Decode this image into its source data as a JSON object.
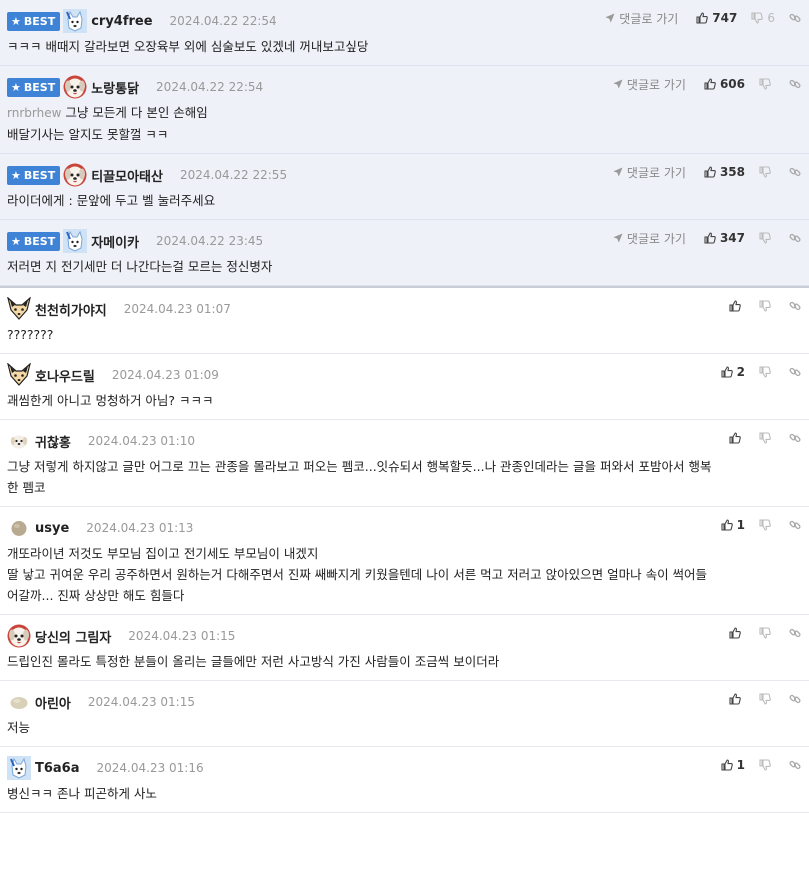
{
  "best_label": "BEST",
  "reply_label": "댓글로 가기",
  "comments": [
    {
      "best": true,
      "avatar": "bluedog-icon",
      "nick": "cry4free",
      "date": "2024.04.22 22:54",
      "up": "747",
      "down": "6",
      "mention": "",
      "lines": [
        "ㅋㅋㅋ 배때지 갈라보면 오장육부 외에 심술보도 있겠네 꺼내보고싶당"
      ]
    },
    {
      "best": true,
      "avatar": "maltese-icon",
      "nick": "노랑통닭",
      "date": "2024.04.22 22:54",
      "up": "606",
      "down": "",
      "mention": "rnrbrhew",
      "lines": [
        "그냥 모든게 다 본인 손해임",
        "배달기사는 알지도 못할껄 ㅋㅋ"
      ]
    },
    {
      "best": true,
      "avatar": "maltese-icon",
      "nick": "티끌모아태산",
      "date": "2024.04.22 22:55",
      "up": "358",
      "down": "",
      "mention": "",
      "lines": [
        "라이더에게 : 문앞에 두고 벨 눌러주세요"
      ]
    },
    {
      "best": true,
      "avatar": "bluedog-icon",
      "nick": "자메이카",
      "date": "2024.04.22 23:45",
      "up": "347",
      "down": "",
      "mention": "",
      "lines": [
        "저러면 지 전기세만 더 나간다는걸 모르는 정신병자"
      ]
    },
    {
      "best": false,
      "avatar": "fox-icon",
      "nick": "천천히가야지",
      "date": "2024.04.23 01:07",
      "up": "",
      "down": "",
      "mention": "",
      "lines": [
        "???????"
      ]
    },
    {
      "best": false,
      "avatar": "fox-icon",
      "nick": "호나우드릴",
      "date": "2024.04.23 01:09",
      "up": "2",
      "down": "",
      "mention": "",
      "lines": [
        "괘씸한게 아니고 멍청하거 아님? ㅋㅋㅋ"
      ]
    },
    {
      "best": false,
      "avatar": "puppy-small-icon",
      "nick": "귀찮홍",
      "date": "2024.04.23 01:10",
      "up": "",
      "down": "",
      "mention": "",
      "lines": [
        "그냥 저렇게 하지않고 글만 어그로 끄는 관종을 몰라보고 퍼오는 펨코...잇슈되서 행복할듯...나 관종인데라는 글을 퍼와서 포밤아서 행복",
        "한 펨코"
      ]
    },
    {
      "best": false,
      "avatar": "stone-small-icon",
      "nick": "usye",
      "date": "2024.04.23 01:13",
      "up": "1",
      "down": "",
      "mention": "",
      "lines": [
        "개또라이년 저것도 부모님 집이고 전기세도 부모님이 내겠지",
        "딸 낳고 귀여운 우리 공주하면서 원하는거 다해주면서 진짜 쌔빠지게 키웠을텐데 나이 서른 먹고 저러고 앉아있으면 얼마나 속이 썩어들",
        "어갈까... 진짜 상상만 해도 힘들다"
      ]
    },
    {
      "best": false,
      "avatar": "maltese-icon",
      "nick": "당신의 그림자",
      "date": "2024.04.23 01:15",
      "up": "",
      "down": "",
      "mention": "",
      "lines": [
        "드립인진 몰라도 특정한 분들이 올리는 글들에만 저런 사고방식 가진 사람들이 조금씩 보이더라"
      ]
    },
    {
      "best": false,
      "avatar": "potato-small-icon",
      "nick": "아린아",
      "date": "2024.04.23 01:15",
      "up": "",
      "down": "",
      "mention": "",
      "lines": [
        "저능"
      ]
    },
    {
      "best": false,
      "avatar": "bluedog-icon",
      "nick": "T6a6a",
      "date": "2024.04.23 01:16",
      "up": "1",
      "down": "",
      "mention": "",
      "lines": [
        "병신ㅋㅋ 존나 피곤하게 사노"
      ]
    }
  ]
}
